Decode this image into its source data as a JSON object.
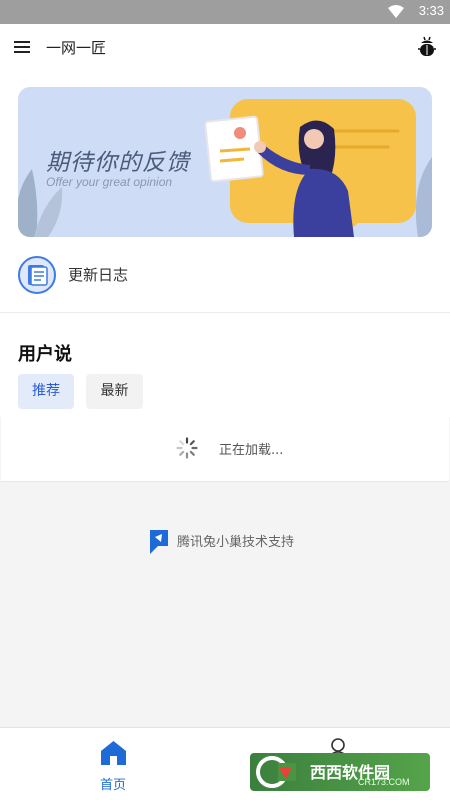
{
  "status_bar": {
    "time": "3:33"
  },
  "app_bar": {
    "title": "一网一匠"
  },
  "banner": {
    "headline": "期待你的反馈",
    "subheadline": "Offer your great opinion"
  },
  "changelog": {
    "label": "更新日志"
  },
  "user_section": {
    "heading": "用户说",
    "tabs": [
      {
        "label": "推荐",
        "selected": true
      },
      {
        "label": "最新",
        "selected": false
      }
    ]
  },
  "loading": {
    "text": "正在加载..."
  },
  "support": {
    "text": "腾讯兔小巢技术支持"
  },
  "bottom_nav": {
    "items": [
      {
        "label": "首页",
        "icon": "home-icon",
        "active": true
      },
      {
        "label": "",
        "icon": "profile-icon",
        "active": false
      }
    ]
  },
  "watermark": {
    "text": "西西软件园",
    "sub": "CR173.COM"
  },
  "colors": {
    "accent": "#1e6bd8",
    "tab_selected_bg": "#e3ebfb",
    "banner_bg": "#cfdcf6",
    "banner_card": "#f6c24a",
    "figure": "#3b3f9e"
  }
}
